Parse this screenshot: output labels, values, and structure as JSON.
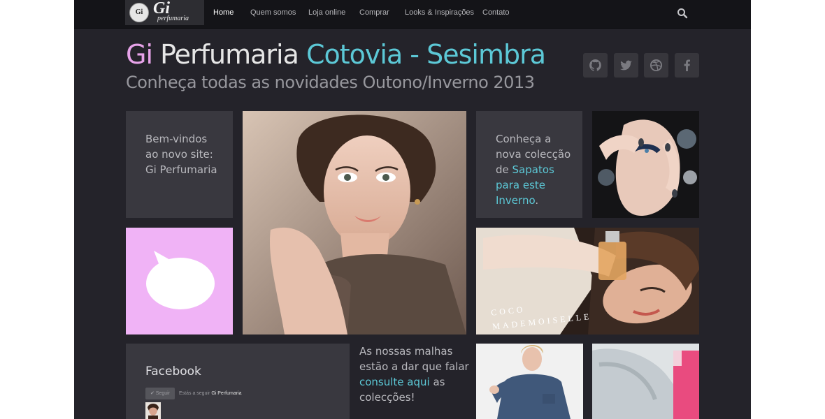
{
  "logo": {
    "badge": "Gi",
    "wordmark": "Gi",
    "sub": "perfumaria"
  },
  "nav": {
    "items": [
      {
        "label": "Home"
      },
      {
        "label": "Quem somos"
      },
      {
        "label": "Loja online"
      },
      {
        "label": "Comprar"
      },
      {
        "label": "Looks & Inspirações"
      },
      {
        "label": "Contato"
      }
    ]
  },
  "header": {
    "title_part1": "Gi",
    "title_part2": " Perfumaria ",
    "title_part3": "Cotovia - Sesimbra",
    "subtitle": "Conheça todas as novidades Outono/Inverno 2013"
  },
  "social": [
    "github-icon",
    "twitter-icon",
    "dribbble-icon",
    "facebook-icon"
  ],
  "tiles": {
    "welcome": {
      "line1": "Bem-vindos",
      "line2": "ao novo site:",
      "line3": "Gi Perfumaria"
    },
    "shoes": {
      "line1": "Conheça a",
      "line2": "nova colecção",
      "line3_pre": "de ",
      "line3_link": "Sapatos",
      "line4": "para este",
      "line5_link": "Inverno",
      "line5_post": "."
    },
    "perfume_caption": "COCO MADEMOISELLE"
  },
  "facebook": {
    "title": "Facebook",
    "button": "✔ Seguir",
    "status_pre": "Estás a seguir ",
    "status_name": "Gi Perfumaria"
  },
  "malhas": {
    "line1": "As nossas malhas",
    "line2": "estão a dar que falar",
    "link": "consulte aqui",
    "line3_post": " as",
    "line4": "colecções!"
  },
  "colors": {
    "accent_pink": "#e7a3e9",
    "accent_cyan": "#5cc8d6",
    "background": "#24232a",
    "tile": "#39383f"
  }
}
